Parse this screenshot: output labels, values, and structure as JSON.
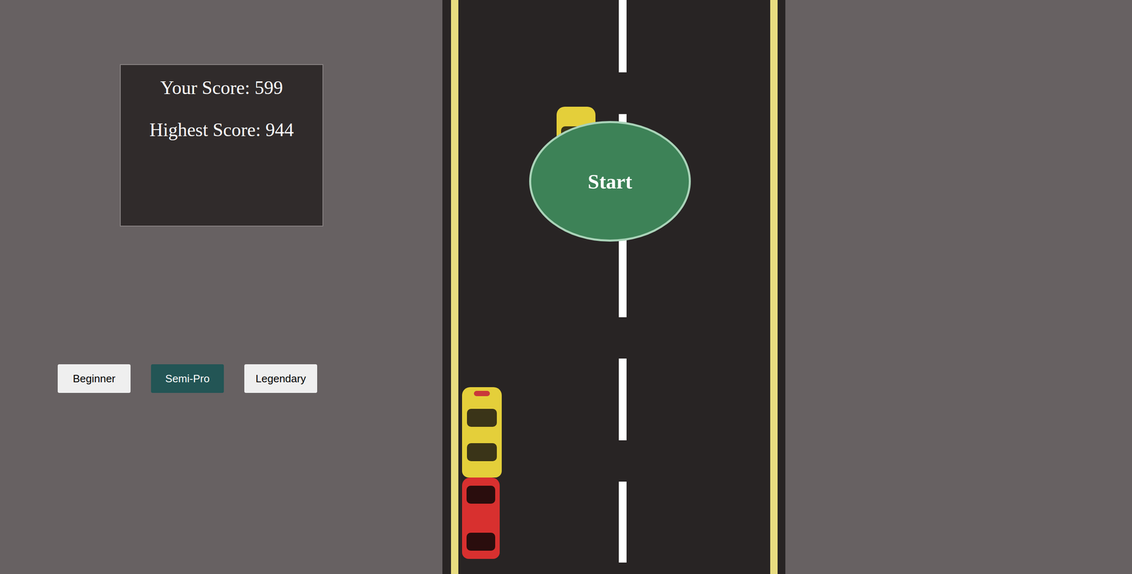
{
  "score_panel": {
    "score": "Your Score: 599",
    "highest": "Highest Score: 944"
  },
  "difficulty": [
    {
      "label": "Beginner",
      "selected": false
    },
    {
      "label": "Semi-Pro",
      "selected": true
    },
    {
      "label": "Legendary",
      "selected": false
    }
  ],
  "start_button": {
    "label": "Start"
  }
}
